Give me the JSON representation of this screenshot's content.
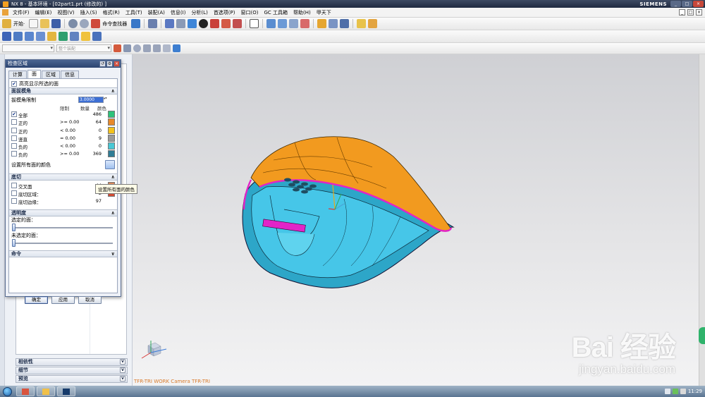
{
  "window": {
    "title": "NX 8 - 基本环境 - [02part1.prt  (修改的) ]",
    "brand": "SIEMENS",
    "controls": [
      "_",
      "□",
      "×"
    ]
  },
  "menubar": {
    "items": [
      "文件(F)",
      "编辑(E)",
      "视图(V)",
      "插入(S)",
      "格式(R)",
      "工具(T)",
      "装配(A)",
      "信息(I)",
      "分析(L)",
      "首选项(P)",
      "窗口(O)",
      "GC 工具箱",
      "帮助(H)",
      "甲天下"
    ]
  },
  "toolbar": {
    "start_label": "开始·",
    "command_finder_label": "命令查找器"
  },
  "selection_bar": {
    "filter_placeholder": "",
    "scope_value": "整个装配"
  },
  "dialog": {
    "title": "检查区域",
    "tabs": [
      "计算",
      "面",
      "区域",
      "信息"
    ],
    "active_tab": "面",
    "highlight_label": "高亮显示所选的面",
    "highlight_checked": true,
    "draft_group": {
      "title": "面拔模角",
      "limit_label": "拔模角限制",
      "limit_value": "3.0000",
      "headers": {
        "limit": "限制",
        "count": "数量",
        "color": "颜色"
      },
      "rows": [
        {
          "label": "全部",
          "cmp": "",
          "count": "486",
          "color": "#2ec27a",
          "checked": true
        },
        {
          "label": "正的",
          "cmp": ">= 0.00",
          "count": "64",
          "color": "#e8892a",
          "checked": false
        },
        {
          "label": "正的",
          "cmp": "< 0.00",
          "count": "0",
          "color": "#f4c21c",
          "checked": false
        },
        {
          "label": "竖直",
          "cmp": "= 0.00",
          "count": "9",
          "color": "#9a9a9a",
          "checked": false
        },
        {
          "label": "负的",
          "cmp": "< 0.00",
          "count": "0",
          "color": "#48c8d6",
          "checked": false
        },
        {
          "label": "负的",
          "cmp": ">= 0.00",
          "count": "369",
          "color": "#2f7d96",
          "checked": false
        }
      ],
      "set_all_label": "设置所有面的颜色",
      "tooltip": "设置所有面的颜色"
    },
    "undercut_group": {
      "title": "底切",
      "rows": [
        {
          "label": "交叉面",
          "count": "44",
          "color": "#d98a5f"
        },
        {
          "label": "底切区域：",
          "count": "2",
          "color": "#d44b32"
        },
        {
          "label": "底切边缘：",
          "count": "97",
          "color": ""
        }
      ]
    },
    "transparency_group": {
      "title": "透明度",
      "selected_label": "选定的面：",
      "selected_value": 0,
      "unselected_label": "未选定的面：",
      "unselected_value": 0
    },
    "command_group": {
      "title": "命令"
    },
    "buttons": {
      "ok": "确定",
      "apply": "应用",
      "cancel": "取消"
    }
  },
  "navigator": {
    "sections": [
      "相依性",
      "细节",
      "预览"
    ]
  },
  "viewport": {
    "status": "TFR-TRI WORK Camera TFR-TRI",
    "watermark_main": "Bai  经验",
    "watermark_sub": "jingyan.baidu.com",
    "model_colors": {
      "draft_positive": "#f29a1f",
      "draft_negative": "#3ec4e6",
      "undercut_edge": "#e224c8"
    }
  },
  "taskbar": {
    "clock": "11:29"
  }
}
